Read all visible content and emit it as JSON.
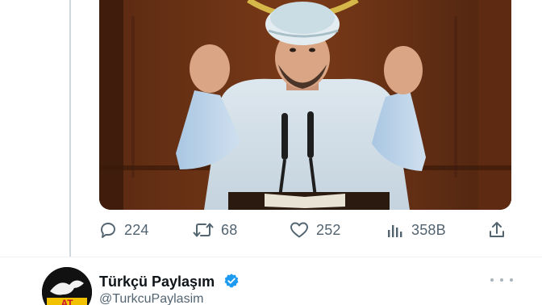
{
  "media": {
    "icon": "video-still-icon"
  },
  "actions": {
    "reply": {
      "icon": "reply-icon",
      "count": "224"
    },
    "retweet": {
      "icon": "retweet-icon",
      "count": "68"
    },
    "like": {
      "icon": "heart-icon",
      "count": "252"
    },
    "views": {
      "icon": "views-chart-icon",
      "count": "358B"
    },
    "share": {
      "icon": "share-icon"
    }
  },
  "next_tweet": {
    "author_name": "Türkçü Paylaşım",
    "handle": "@TurkcuPaylasim",
    "verified_icon": "verified-badge-icon",
    "avatar_text": "AT",
    "more_icon": "more-options-icon"
  },
  "colors": {
    "icon_gray": "#536471",
    "verified_blue": "#1d9bf0",
    "text_dark": "#0f1419"
  }
}
